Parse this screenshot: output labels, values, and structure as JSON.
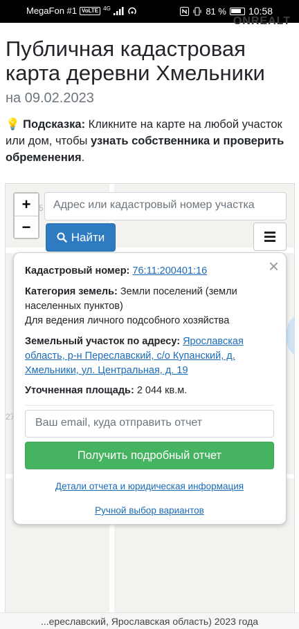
{
  "status_bar": {
    "carrier": "MegaFon #1",
    "volte": "VoLTE",
    "network": "4G",
    "battery": "81 %",
    "time": "10:58"
  },
  "watermark": "ONREALT",
  "page": {
    "title": "Публичная кадастровая карта деревни Хмельники",
    "date": "на 09.02.2023",
    "hint": {
      "icon": "💡",
      "label": "Подсказка:",
      "text1": "Кликните на карте на любой участок или дом, чтобы",
      "bold": "узнать собственника и проверить обременения",
      "end": "."
    }
  },
  "map": {
    "zoom_in": "+",
    "zoom_out": "−",
    "search_placeholder": "Адрес или кадастровый номер участка",
    "search_button": "Найти",
    "side_labels": [
      "5",
      "27"
    ]
  },
  "popup": {
    "close": "×",
    "cadastral_label": "Кадастровый номер:",
    "cadastral_value": "76:11:200401:16",
    "category_label": "Категория земель:",
    "category_value": "Земли поселений (земли населенных пунктов)",
    "usage": "Для ведения личного подсобного хозяйства",
    "address_label": "Земельный участок по адресу:",
    "address_value": "Ярославская область, р-н Переславский, с/о Купанский, д. Хмельники, ул. Центральная, д. 19",
    "area_label": "Уточненная площадь:",
    "area_value": "2 044 кв.м.",
    "email_placeholder": "Ваш email, куда отправить отчет",
    "report_button": "Получить подробный отчет",
    "details_link": "Детали отчета и юридическая информация",
    "manual_link": "Ручной выбор вариантов"
  },
  "footer": "...ереславский, Ярославская область) 2023 года"
}
